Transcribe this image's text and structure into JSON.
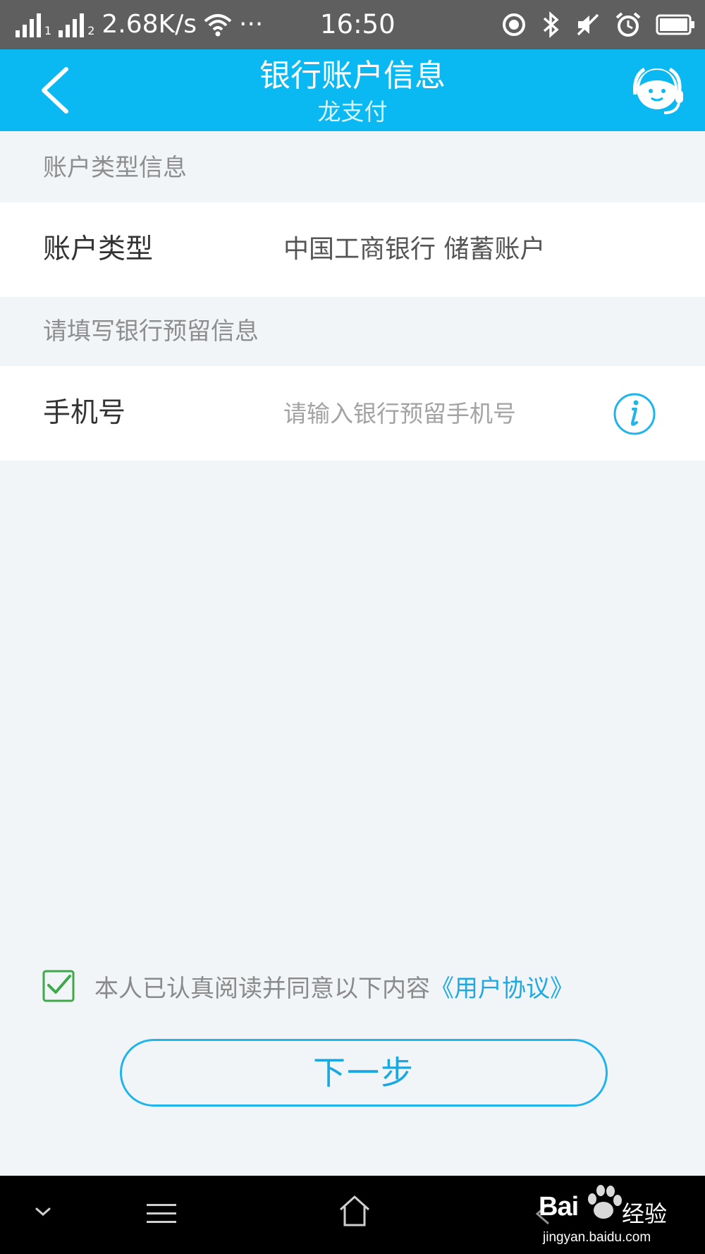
{
  "status_bar": {
    "sim1": "1",
    "sim2": "2",
    "speed": "2.68K/s",
    "more": "···",
    "time": "16:50"
  },
  "nav": {
    "title": "银行账户信息",
    "subtitle": "龙支付"
  },
  "sections": {
    "account_type_header": "账户类型信息",
    "reserved_info_header": "请填写银行预留信息"
  },
  "account_type_row": {
    "label": "账户类型",
    "value": "中国工商银行 储蓄账户"
  },
  "phone_row": {
    "label": "手机号",
    "placeholder": "请输入银行预留手机号",
    "value": ""
  },
  "agreement": {
    "checked": true,
    "text": "本人已认真阅读并同意以下内容",
    "link": "《用户协议》"
  },
  "next_button": {
    "label": "下一步"
  },
  "watermark": {
    "brand": "Bai",
    "brand_suffix": "经验",
    "url": "jingyan.baidu.com"
  },
  "colors": {
    "accent": "#0bb9f2",
    "link": "#1fa9e3",
    "checkbox": "#3ea84a",
    "background": "#f2f5f8"
  },
  "icons": {
    "back": "back-chevron-icon",
    "customer_service": "customer-service-icon",
    "info": "info-icon",
    "checkbox": "checkmark-icon"
  }
}
